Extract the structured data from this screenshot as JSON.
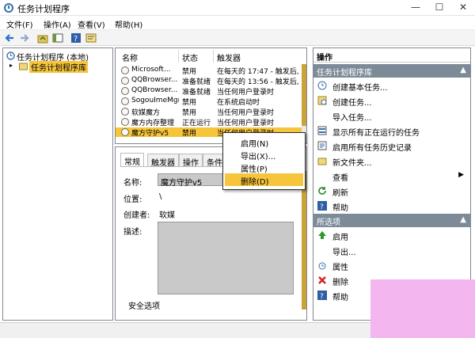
{
  "window": {
    "title": "任务计划程序"
  },
  "menu": {
    "file": "文件(F)",
    "action": "操作(A)",
    "view": "查看(V)",
    "help": "帮助(H)"
  },
  "tree": {
    "root": "任务计划程序 (本地)",
    "library": "任务计划程序库"
  },
  "task_list": {
    "columns": {
      "name": "名称",
      "status": "状态",
      "trigger": "触发器"
    },
    "rows": [
      {
        "name": "Microsoft...",
        "status": "禁用",
        "trigger": "在每天的 17:47 - 触发后,"
      },
      {
        "name": "QQBrowser...",
        "status": "准备就绪",
        "trigger": "在每天的 13:56 - 触发后,"
      },
      {
        "name": "QQBrowser...",
        "status": "准备就绪",
        "trigger": "当任何用户登录时"
      },
      {
        "name": "SogouImeMgr",
        "status": "禁用",
        "trigger": "在系统启动时"
      },
      {
        "name": "软媒魔方",
        "status": "禁用",
        "trigger": "当任何用户登录时"
      },
      {
        "name": "魔方内存整理",
        "status": "正在运行",
        "trigger": "当任何用户登录时"
      },
      {
        "name": "魔方守护v5",
        "status": "禁用",
        "trigger": "当任何用户登录时"
      }
    ]
  },
  "context_menu": {
    "items": [
      "启用(N)",
      "导出(X)...",
      "属性(P)",
      "删除(D)"
    ]
  },
  "properties": {
    "tabs": [
      "常规",
      "触发器",
      "操作",
      "条件"
    ],
    "name_label": "名称:",
    "name_value": "魔方守护v5",
    "location_label": "位置:",
    "location_value": "\\",
    "author_label": "创建者:",
    "author_value": "软媒",
    "desc_label": "描述:",
    "security_label": "安全选项"
  },
  "actions": {
    "title": "操作",
    "library_section": "任务计划程序库",
    "library_items": [
      "创建基本任务...",
      "创建任务...",
      "导入任务...",
      "显示所有正在运行的任务",
      "启用所有任务历史记录",
      "新文件夹...",
      "查看",
      "刷新",
      "帮助"
    ],
    "selected_section": "所选项",
    "selected_items": [
      "启用",
      "导出...",
      "属性",
      "删除",
      "帮助"
    ]
  },
  "colors": {
    "selection": "#f6c53c",
    "section_header": "#7d8b99",
    "pink_block": "#f3b6ef"
  }
}
